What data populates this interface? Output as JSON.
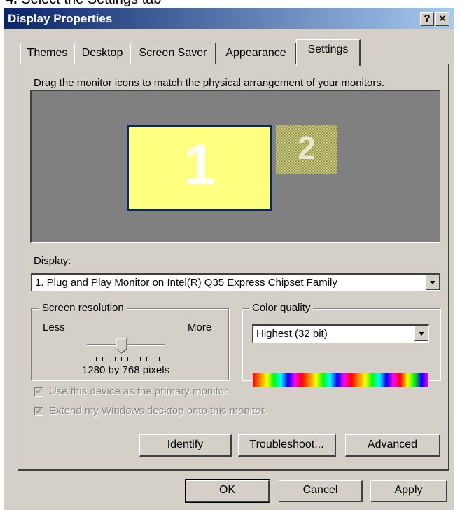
{
  "caption": {
    "step": "4.",
    "text": "Select the Settings tab"
  },
  "window": {
    "title": "Display Properties",
    "help_button": "?",
    "close_button": "×"
  },
  "tabs": [
    {
      "label": "Themes",
      "active": false
    },
    {
      "label": "Desktop",
      "active": false
    },
    {
      "label": "Screen Saver",
      "active": false
    },
    {
      "label": "Appearance",
      "active": false
    },
    {
      "label": "Settings",
      "active": true
    }
  ],
  "settings": {
    "instruction": "Drag the monitor icons to match the physical arrangement of your monitors.",
    "monitors": [
      {
        "number": "1",
        "active": true
      },
      {
        "number": "2",
        "active": false
      }
    ],
    "display_label": "Display:",
    "display_value": "1. Plug and Play Monitor on Intel(R) Q35 Express Chipset Family",
    "resolution": {
      "legend": "Screen resolution",
      "less_label": "Less",
      "more_label": "More",
      "value_text": "1280 by 768 pixels",
      "slider_level_percent": 45
    },
    "color_quality": {
      "legend": "Color quality",
      "value": "Highest (32 bit)"
    },
    "primary_monitor_label": "Use this device as the primary monitor.",
    "extend_desktop_label": "Extend my Windows desktop onto this monitor.",
    "identify_button": "Identify",
    "troubleshoot_button": "Troubleshoot...",
    "advanced_button": "Advanced"
  },
  "footer": {
    "ok_button": "OK",
    "cancel_button": "Cancel",
    "apply_button": "Apply"
  },
  "colors": {
    "titlebar_start": "#0a246a",
    "titlebar_end": "#a6caf0",
    "dialog_bg": "#d4d0c8",
    "monitor_area": "#808080",
    "monitor_primary": "#ffff80"
  }
}
